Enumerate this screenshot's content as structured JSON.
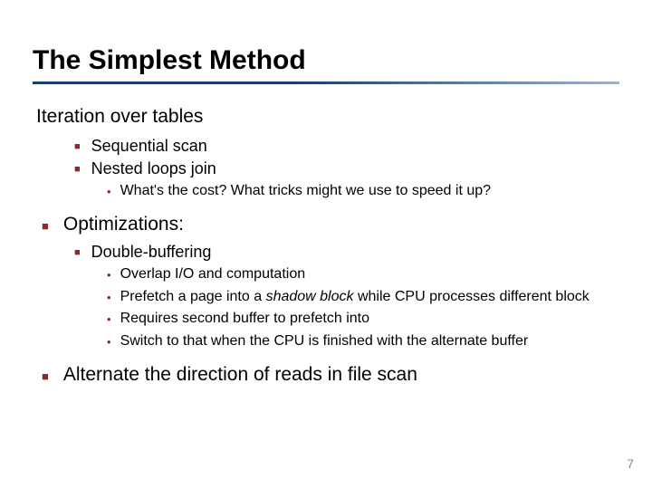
{
  "title": "The Simplest Method",
  "section1": "Iteration over tables",
  "bullets_a": [
    "Sequential scan",
    "Nested loops join"
  ],
  "sub_a": [
    "What's the cost?  What tricks might we use to speed it up?"
  ],
  "section2": "Optimizations:",
  "bullets_b": [
    "Double-buffering"
  ],
  "sub_b_pre": "Prefetch a page into a ",
  "sub_b_em": "shadow block",
  "sub_b_post": " while CPU processes different block",
  "sub_b": [
    "Overlap I/O and computation",
    "",
    "Requires second buffer to prefetch into",
    "Switch to that when the CPU is finished with the alternate buffer"
  ],
  "section3": "Alternate the direction of reads in file scan",
  "page": "7"
}
